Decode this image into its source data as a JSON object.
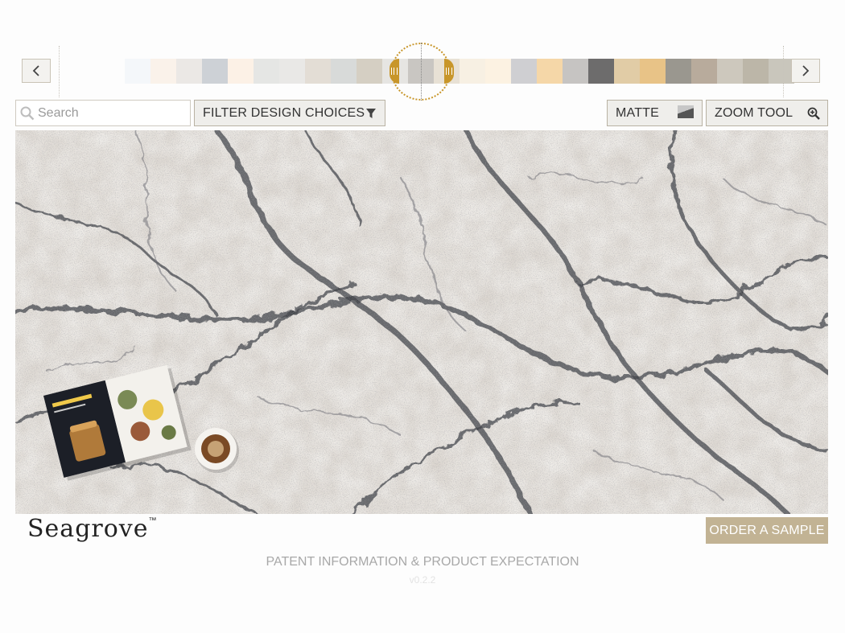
{
  "carousel": {
    "prev_icon": "chevron-left-icon",
    "next_icon": "chevron-right-icon",
    "swatches": [
      "#f4f7fa",
      "#faf2ea",
      "#ebe8e5",
      "#cdd1d6",
      "#fcf1e6",
      "#e5e6e4",
      "#e9e8e6",
      "#e3ddd5",
      "#d8dad9",
      "#d5cfc3",
      "#e6e5e2",
      "#c9c6c2",
      "#e8e1d5",
      "#f7f0e3",
      "#fcf2e2",
      "#cfcfd2",
      "#f5d7a8",
      "#c6c4c2",
      "#6d6c6c",
      "#e1cca6",
      "#e8c387",
      "#9a978f",
      "#b8ab9c",
      "#cdc8bd",
      "#bcb6a8",
      "#c9c6bc"
    ],
    "selected_index": 11,
    "accent": "#c8962a"
  },
  "toolbar": {
    "search_placeholder": "Search",
    "filter_label": "FILTER DESIGN CHOICES",
    "finish_label": "MATTE",
    "zoom_label": "ZOOM TOOL"
  },
  "product": {
    "name": "Seagrove",
    "trademark": "TM",
    "order_label": "ORDER A SAMPLE",
    "order_color": "#c2b394"
  },
  "footer": {
    "patent_label": "PATENT INFORMATION & PRODUCT EXPECTATION",
    "version": "v0.2.2"
  }
}
